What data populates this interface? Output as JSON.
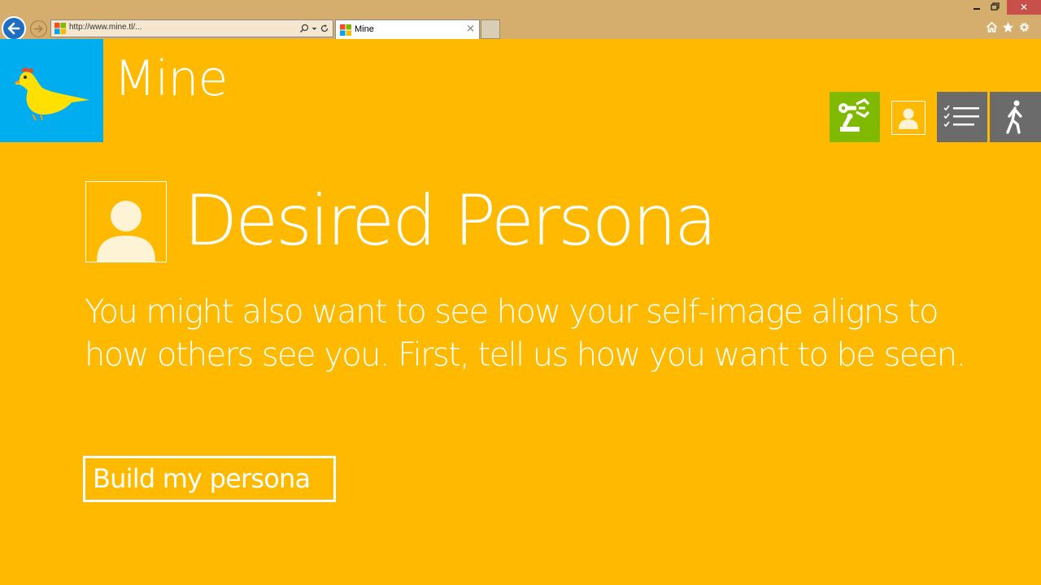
{
  "browser": {
    "url": "http://www.mine.tl/...",
    "tab_title": "Mine",
    "tab_close": "×",
    "window_close": "✕",
    "icons": [
      "back-arrow-icon",
      "forward-arrow-icon",
      "search-icon",
      "refresh-icon",
      "home-icon",
      "favorites-star-icon",
      "settings-gear-icon"
    ]
  },
  "app": {
    "title": "Mine",
    "logo_icon": "bird-logo-icon",
    "header_buttons": [
      "robot-arm-icon",
      "profile-icon",
      "checklist-icon",
      "exit-walking-icon"
    ]
  },
  "main": {
    "title": "Desired Persona",
    "description": "You might also want to see how your self-image aligns to how others see you. First, tell us how you want to be seen.",
    "build_button": "Build my persona"
  },
  "colors": {
    "background": "#FFBA00",
    "logo_tile": "#00AEEF",
    "robot_button": "#7FBA00",
    "dark_buttons": "#6B6B6B",
    "text": "#FFFFFF",
    "avatar_fill": "#FFF3D6"
  }
}
